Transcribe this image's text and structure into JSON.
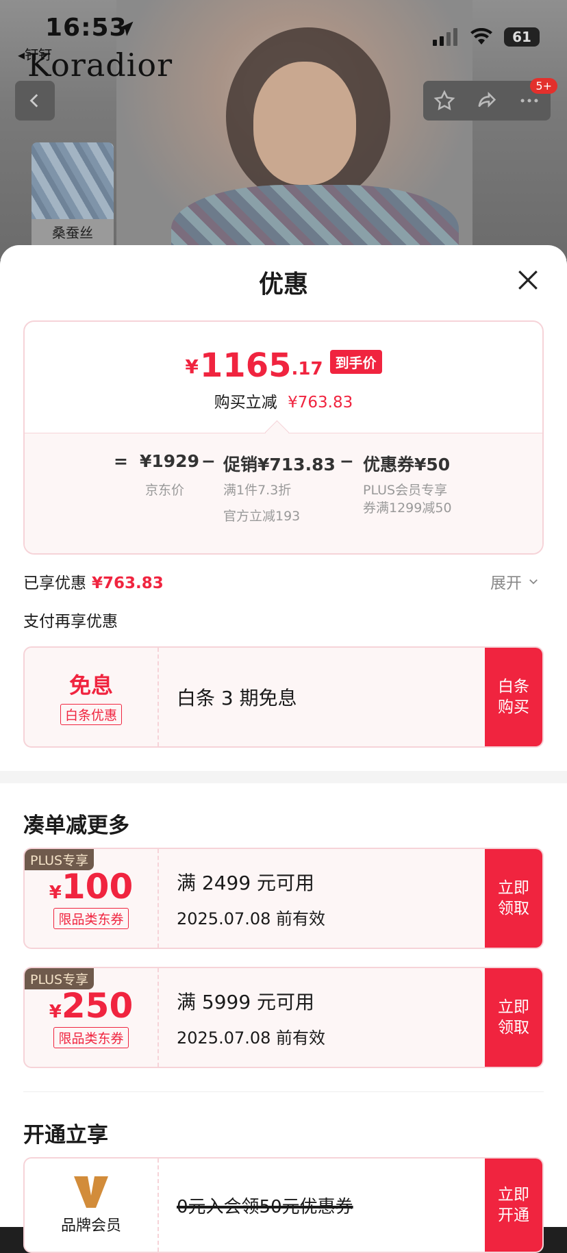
{
  "status_bar": {
    "time": "16:53",
    "battery": "61",
    "back_app": "◂钉钉"
  },
  "brand": "Koradior",
  "thumbnail_label": "桑蚕丝",
  "badge": "5+",
  "sheet": {
    "title": "优惠",
    "final_price": {
      "currency": "¥",
      "integer": "1165",
      "decimal": ".17",
      "tag": "到手价"
    },
    "reduce_label": "购买立减",
    "reduce_value": "¥763.83",
    "breakdown": {
      "eq": "=",
      "jd_price": "¥1929",
      "jd_label": "京东价",
      "minus1": "−",
      "promo": "促销¥713.83",
      "promo_sub1": "满1件7.3折",
      "promo_sub2": "官方立减193",
      "minus2": "−",
      "coupon": "优惠券¥50",
      "coupon_sub": "PLUS会员专享券满1299减50"
    },
    "enjoyed_label": "已享优惠",
    "enjoyed_value": "¥763.83",
    "expand_label": "展开",
    "pay_title": "支付再享优惠",
    "baitiao": {
      "main": "免息",
      "tag": "白条优惠",
      "desc": "白条 3 期免息",
      "action": "白条购买"
    },
    "more_title": "凑单减更多",
    "coupons": [
      {
        "plus_tag": "PLUS专享",
        "currency": "¥",
        "amount": "100",
        "tag": "限品类东券",
        "cond": "满 2499 元可用",
        "expire": "2025.07.08 前有效",
        "action": "立即领取"
      },
      {
        "plus_tag": "PLUS专享",
        "currency": "¥",
        "amount": "250",
        "tag": "限品类东券",
        "cond": "满 5999 元可用",
        "expire": "2025.07.08 前有效",
        "action": "立即领取"
      }
    ],
    "open_title": "开通立享",
    "member": {
      "name": "品牌会员",
      "desc": "0元入会领50元优惠券",
      "action": "立即开通"
    }
  },
  "colors": {
    "accent": "#f0243f",
    "border": "#f6d3d8",
    "card_bg": "#fdf6f6"
  }
}
